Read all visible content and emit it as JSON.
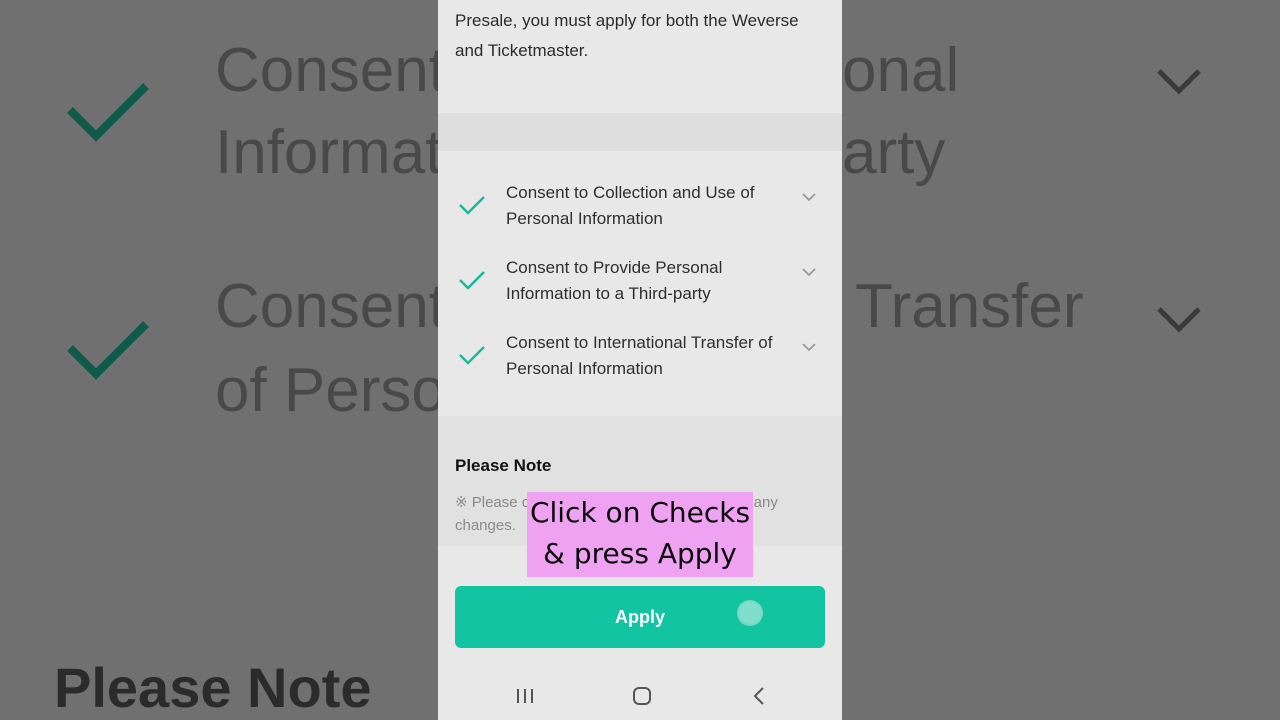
{
  "background": {
    "lines": [
      "Consent",
      "Informat",
      "onal",
      "arty",
      "Consent",
      "Transfer",
      "of Perso"
    ],
    "note": "Please Note"
  },
  "intro": {
    "text": "Presale, you must apply for both the Weverse and Ticketmaster."
  },
  "consents": [
    {
      "label": "Consent to Collection and Use of Personal Information",
      "checked": true
    },
    {
      "label": "Consent to Provide Personal Information to a Third-party",
      "checked": true
    },
    {
      "label": "Consent to International Transfer of Personal Information",
      "checked": true
    }
  ],
  "note": {
    "title": "Please Note",
    "body_start": "※ Please c",
    "body_end": "e are any",
    "body_line2": "changes."
  },
  "apply": {
    "label": "Apply"
  },
  "caption": {
    "line1": "Click on Checks",
    "line2": "& press Apply"
  },
  "colors": {
    "accent": "#13c4a3",
    "check": "#16b99a",
    "caption_bg": "#f0a2f2"
  },
  "icons": {
    "check": "check-icon",
    "chevron": "chevron-down-icon",
    "nav_recent": "recent-apps-icon",
    "nav_home": "home-icon",
    "nav_back": "back-icon"
  }
}
